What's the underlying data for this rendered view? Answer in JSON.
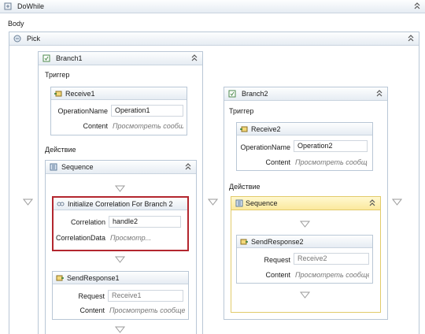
{
  "dowhile": {
    "title": "DoWhile",
    "body_label": "Body"
  },
  "pick": {
    "title": "Pick"
  },
  "branch1": {
    "title": "Branch1",
    "trigger_label": "Триггер",
    "receive": {
      "title": "Receive1",
      "operation_label": "OperationName",
      "operation_value": "Operation1",
      "content_label": "Content",
      "content_link": "Просмотреть сообщение..."
    },
    "action_label": "Действие",
    "sequence": {
      "title": "Sequence",
      "init": {
        "title": "Initialize Correlation For Branch 2",
        "correlation_label": "Correlation",
        "correlation_value": "handle2",
        "data_label": "CorrelationData",
        "data_link": "Просмотр..."
      },
      "send": {
        "title": "SendResponse1",
        "request_label": "Request",
        "request_value": "Receive1",
        "content_label": "Content",
        "content_link": "Просмотреть сообщение..."
      }
    }
  },
  "branch2": {
    "title": "Branch2",
    "trigger_label": "Триггер",
    "receive": {
      "title": "Receive2",
      "operation_label": "OperationName",
      "operation_value": "Operation2",
      "content_label": "Content",
      "content_link": "Просмотреть сообщение..."
    },
    "action_label": "Действие",
    "sequence": {
      "title": "Sequence",
      "send": {
        "title": "SendResponse2",
        "request_label": "Request",
        "request_value": "Receive2",
        "content_label": "Content",
        "content_link": "Просмотреть сообщение..."
      }
    }
  },
  "colors": {
    "selection": "#b3262e",
    "highlight": "#fbe99d",
    "border": "#b9c7d6"
  },
  "icons": [
    "dowhile-icon",
    "pick-icon",
    "branch-icon",
    "receive-icon",
    "sequence-icon",
    "correlation-icon",
    "send-icon",
    "collapse-icon",
    "drop-arrow-icon"
  ]
}
